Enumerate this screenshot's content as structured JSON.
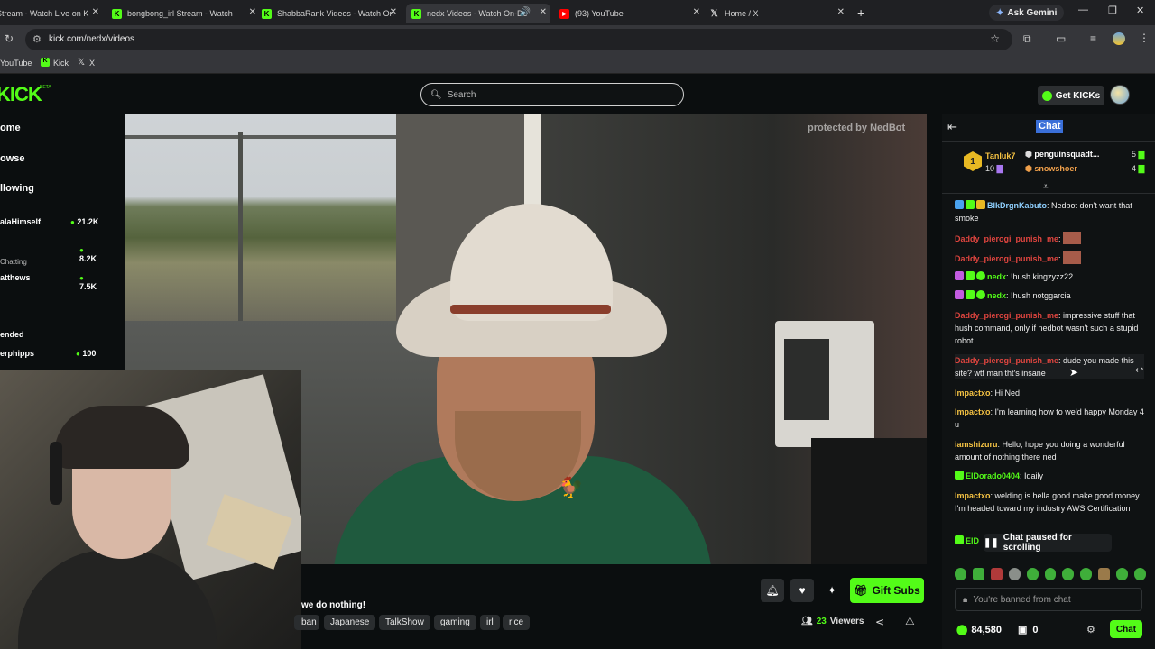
{
  "browser": {
    "tabs": [
      {
        "title": "Stream - Watch Live on K",
        "color": "#53fc18",
        "glyph": "K"
      },
      {
        "title": "bongbong_irl Stream - Watch",
        "color": "#53fc18",
        "glyph": "K"
      },
      {
        "title": "ShabbaRank Videos - Watch On",
        "color": "#53fc18",
        "glyph": "K"
      },
      {
        "title": "nedx Videos - Watch On-De",
        "color": "#53fc18",
        "glyph": "K"
      },
      {
        "title": "(93) YouTube",
        "color": "#ff0000",
        "glyph": "▶"
      },
      {
        "title": "Home / X",
        "color": "#dddddd",
        "glyph": "X"
      }
    ],
    "new_tab": "+",
    "gemini": "Ask Gemini",
    "url": "kick.com/nedx/videos",
    "bookmarks": [
      "YouTube",
      "Kick",
      "X"
    ]
  },
  "header": {
    "logo": "KICK",
    "logo_beta": "BETA",
    "search_placeholder": "Search",
    "get_kicks": "Get KICKs"
  },
  "sidebar": {
    "nav": [
      "ome",
      "owse",
      "llowing"
    ],
    "channels": [
      {
        "name": "alaHimself",
        "viewers": "21.2K"
      },
      {
        "name": "",
        "viewers": "8.2K"
      },
      {
        "name": "Chatting",
        "viewers": ""
      },
      {
        "name": "atthews",
        "viewers": "7.5K"
      }
    ],
    "section": "ended",
    "recommended": [
      {
        "name": "erphipps",
        "viewers": "100"
      }
    ]
  },
  "video": {
    "watermark": "protected by NedBot"
  },
  "stream": {
    "title_fragment": "we do nothing!",
    "tags": [
      "ban",
      "Japanese",
      "TalkShow",
      "gaming",
      "irl",
      "rice"
    ],
    "viewers_count": "23",
    "viewers_label": "Viewers",
    "gift_subs": "Gift Subs"
  },
  "chat": {
    "title": "Chat",
    "leaderboard": [
      {
        "rank": "1",
        "name": "Tanluk7",
        "count": "10"
      },
      {
        "rank": "",
        "name": "penguinsquadt...",
        "count": "5"
      },
      {
        "rank": "",
        "name": "snowshoer",
        "count": "4"
      }
    ],
    "messages": [
      {
        "user": "BlkDrgnKabuto",
        "user_color": "#53fc18",
        "text": "Nedbot don't want that smoke"
      },
      {
        "user": "Daddy_pierogi_punish_me",
        "user_color": "#e0453f",
        "text": ""
      },
      {
        "user": "Daddy_pierogi_punish_me",
        "user_color": "#e0453f",
        "text": ""
      },
      {
        "user": "nedx",
        "user_color": "#53fc18",
        "text": "!hush kingzyzz22"
      },
      {
        "user": "nedx",
        "user_color": "#53fc18",
        "text": "!hush notggarcia"
      },
      {
        "user": "Daddy_pierogi_punish_me",
        "user_color": "#e0453f",
        "text": "impressive stuff that hush command, only if nedbot wasn't such a stupid robot"
      },
      {
        "user": "Daddy_pierogi_punish_me",
        "user_color": "#e0453f",
        "text": "dude you made this site? wtf man tht's insane"
      },
      {
        "user": "Impactxo",
        "user_color": "#f6c343",
        "text": "Hi Ned"
      },
      {
        "user": "Impactxo",
        "user_color": "#f6c343",
        "text": "I'm learning how to weld happy Monday 4 u"
      },
      {
        "user": "iamshizuru",
        "user_color": "#f6c343",
        "text": "Hello, hope you doing a wonderful amount of nothing there ned"
      },
      {
        "user": "ElDorado0404",
        "user_color": "#53fc18",
        "text": "Idaily"
      },
      {
        "user": "Impactxo",
        "user_color": "#f6c343",
        "text": "welding is hella good make good money I'm headed toward my industry AWS Certification"
      },
      {
        "user": "ElD",
        "user_color": "#53fc18",
        "text": ""
      }
    ],
    "paused": "Chat paused for scrolling",
    "banned_placeholder": "You're banned from chat",
    "kicks_balance": "84,580",
    "gift_count": "0",
    "send_button": "Chat"
  }
}
